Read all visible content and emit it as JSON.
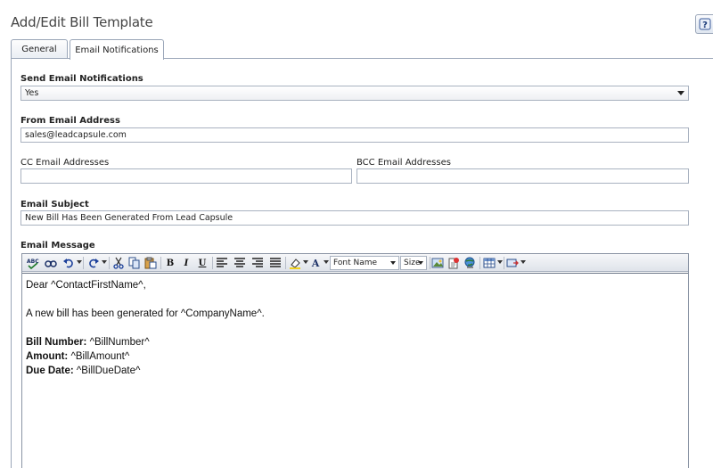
{
  "header": {
    "title": "Add/Edit Bill Template",
    "help_icon": "help-question-icon"
  },
  "tabs": [
    {
      "label": "General",
      "active": false
    },
    {
      "label": "Email Notifications",
      "active": true
    }
  ],
  "form": {
    "send_notifications": {
      "label": "Send Email Notifications",
      "value": "Yes"
    },
    "from_email": {
      "label": "From Email Address",
      "value": "sales@leadcapsule.com"
    },
    "cc_emails": {
      "label": "CC Email Addresses",
      "value": ""
    },
    "bcc_emails": {
      "label": "BCC Email Addresses",
      "value": ""
    },
    "subject": {
      "label": "Email Subject",
      "value": "New Bill Has Been Generated From Lead Capsule"
    },
    "message": {
      "label": "Email Message"
    }
  },
  "editor": {
    "toolbar": {
      "font_name": "Font Name",
      "size": "Size",
      "bold": "B",
      "italic": "I",
      "underline": "U",
      "font_color": "A",
      "icons": [
        "spellcheck-icon",
        "find-replace-icon",
        "undo-icon",
        "redo-icon",
        "cut-icon",
        "copy-icon",
        "paste-icon",
        "bold-icon",
        "italic-icon",
        "underline-icon",
        "align-left-icon",
        "align-center-icon",
        "align-right-icon",
        "justify-icon",
        "highlight-icon",
        "font-color-icon",
        "image-manager-icon",
        "document-manager-icon",
        "hyperlink-icon",
        "table-icon",
        "insert-element-icon"
      ]
    },
    "content": {
      "greeting": "Dear ^ContactFirstName^,",
      "line1": "A new bill has been generated for ^CompanyName^.",
      "bill_number_label": "Bill Number:",
      "bill_number_value": " ^BillNumber^",
      "amount_label": "Amount:",
      "amount_value": " ^BillAmount^",
      "due_date_label": "Due Date:",
      "due_date_value": " ^BillDueDate^"
    }
  },
  "colors": {
    "border": "#9aa6b8",
    "toolbar_bg": "#dfe3ea",
    "icon_blue": "#1a2f66"
  }
}
